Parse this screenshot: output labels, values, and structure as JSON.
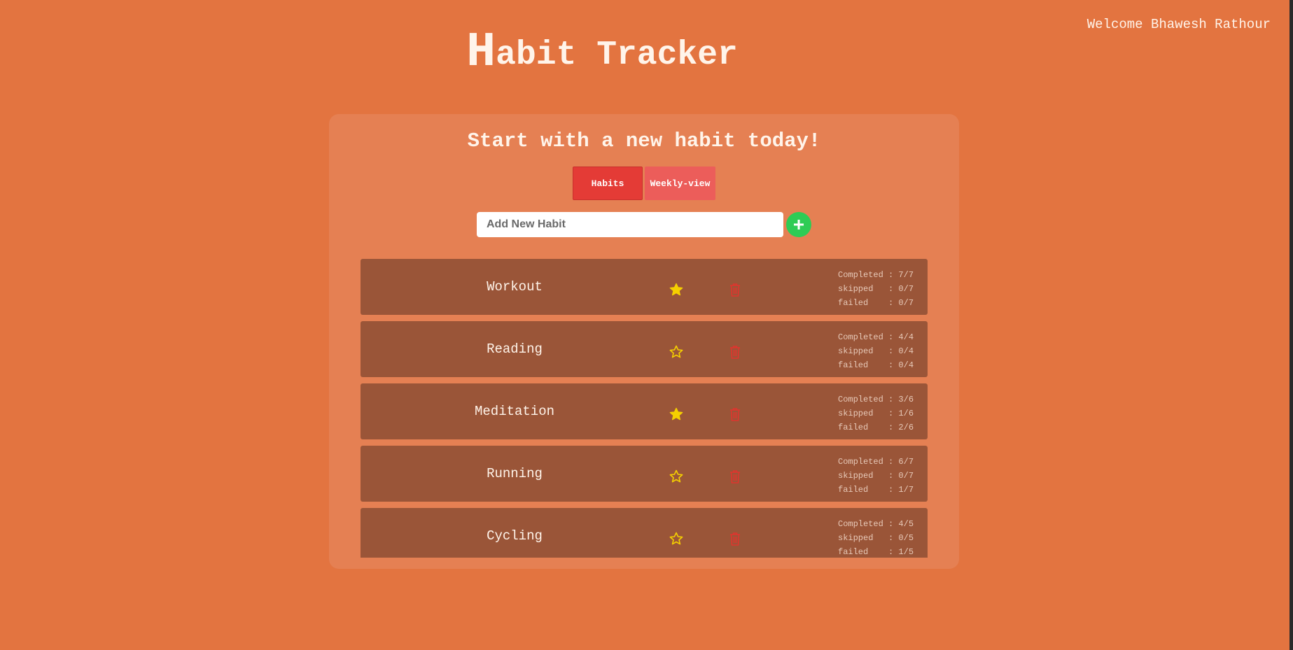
{
  "header": {
    "title_first_letter": "H",
    "title_rest": "abit Tracker",
    "welcome": "Welcome Bhawesh Rathour"
  },
  "card": {
    "tagline": "Start with a new habit today!",
    "tabs": [
      {
        "label": "Habits",
        "active": true
      },
      {
        "label": "Weekly-view",
        "active": false
      }
    ],
    "add_habit": {
      "placeholder": "Add New Habit",
      "value": "",
      "button_icon": "plus-icon"
    }
  },
  "habits": [
    {
      "name": "Workout",
      "favorite": true,
      "stats": [
        "Completed : 7/7",
        "skipped   : 0/7",
        "failed    : 0/7"
      ]
    },
    {
      "name": "Reading",
      "favorite": false,
      "stats": [
        "Completed : 4/4",
        "skipped   : 0/4",
        "failed    : 0/4"
      ]
    },
    {
      "name": "Meditation",
      "favorite": true,
      "stats": [
        "Completed : 3/6",
        "skipped   : 1/6",
        "failed    : 2/6"
      ]
    },
    {
      "name": "Running",
      "favorite": false,
      "stats": [
        "Completed : 6/7",
        "skipped   : 0/7",
        "failed    : 1/7"
      ]
    },
    {
      "name": "Cycling",
      "favorite": false,
      "stats": [
        "Completed : 4/5",
        "skipped   : 0/5",
        "failed    : 1/5"
      ]
    }
  ],
  "colors": {
    "background": "#e37440",
    "card": "#e58053",
    "habit_row": "#9a5538",
    "tab_active": "#e43b36",
    "tab_inactive": "#ec5d5a",
    "add_button": "#2ecc55",
    "star": "#f5d000",
    "trash": "#e0352e"
  }
}
